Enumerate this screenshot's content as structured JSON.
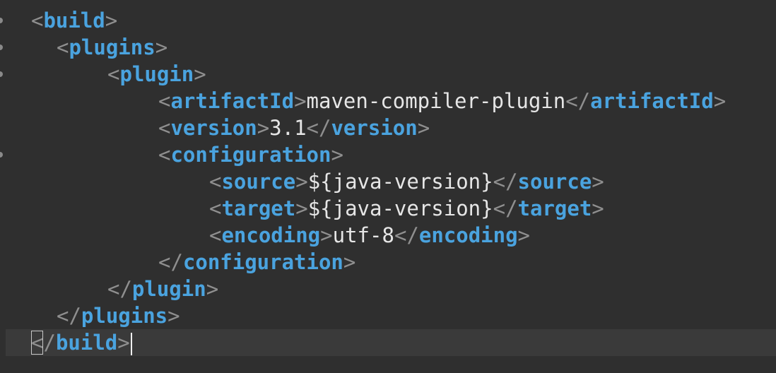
{
  "editor": {
    "colors": {
      "background": "#2f2f2f",
      "current_line": "#3a3a3a",
      "tag": "#4aa3df",
      "bracket": "#8f8f8f",
      "text": "#e6e6e6"
    },
    "lines": [
      {
        "indent": 0,
        "parts": [
          {
            "k": "b",
            "t": "<"
          },
          {
            "k": "g",
            "t": "build"
          },
          {
            "k": "b",
            "t": ">"
          }
        ]
      },
      {
        "indent": 1,
        "parts": [
          {
            "k": "b",
            "t": "<"
          },
          {
            "k": "g",
            "t": "plugins"
          },
          {
            "k": "b",
            "t": ">"
          }
        ]
      },
      {
        "indent": 3,
        "parts": [
          {
            "k": "b",
            "t": "<"
          },
          {
            "k": "g",
            "t": "plugin"
          },
          {
            "k": "b",
            "t": ">"
          }
        ]
      },
      {
        "indent": 5,
        "parts": [
          {
            "k": "b",
            "t": "<"
          },
          {
            "k": "g",
            "t": "artifactId"
          },
          {
            "k": "b",
            "t": ">"
          },
          {
            "k": "x",
            "t": "maven-compiler-plugin"
          },
          {
            "k": "b",
            "t": "</"
          },
          {
            "k": "g",
            "t": "artifactId"
          },
          {
            "k": "b",
            "t": ">"
          }
        ]
      },
      {
        "indent": 5,
        "parts": [
          {
            "k": "b",
            "t": "<"
          },
          {
            "k": "g",
            "t": "version"
          },
          {
            "k": "b",
            "t": ">"
          },
          {
            "k": "x",
            "t": "3.1"
          },
          {
            "k": "b",
            "t": "</"
          },
          {
            "k": "g",
            "t": "version"
          },
          {
            "k": "b",
            "t": ">"
          }
        ]
      },
      {
        "indent": 5,
        "parts": [
          {
            "k": "b",
            "t": "<"
          },
          {
            "k": "g",
            "t": "configuration"
          },
          {
            "k": "b",
            "t": ">"
          }
        ]
      },
      {
        "indent": 7,
        "parts": [
          {
            "k": "b",
            "t": "<"
          },
          {
            "k": "g",
            "t": "source"
          },
          {
            "k": "b",
            "t": ">"
          },
          {
            "k": "x",
            "t": "${java-version}"
          },
          {
            "k": "b",
            "t": "</"
          },
          {
            "k": "g",
            "t": "source"
          },
          {
            "k": "b",
            "t": ">"
          }
        ]
      },
      {
        "indent": 7,
        "parts": [
          {
            "k": "b",
            "t": "<"
          },
          {
            "k": "g",
            "t": "target"
          },
          {
            "k": "b",
            "t": ">"
          },
          {
            "k": "x",
            "t": "${java-version}"
          },
          {
            "k": "b",
            "t": "</"
          },
          {
            "k": "g",
            "t": "target"
          },
          {
            "k": "b",
            "t": ">"
          }
        ]
      },
      {
        "indent": 7,
        "parts": [
          {
            "k": "b",
            "t": "<"
          },
          {
            "k": "g",
            "t": "encoding"
          },
          {
            "k": "b",
            "t": ">"
          },
          {
            "k": "x",
            "t": "utf-8"
          },
          {
            "k": "b",
            "t": "</"
          },
          {
            "k": "g",
            "t": "encoding"
          },
          {
            "k": "b",
            "t": ">"
          }
        ]
      },
      {
        "indent": 5,
        "parts": [
          {
            "k": "b",
            "t": "</"
          },
          {
            "k": "g",
            "t": "configuration"
          },
          {
            "k": "b",
            "t": ">"
          }
        ]
      },
      {
        "indent": 3,
        "parts": [
          {
            "k": "b",
            "t": "</"
          },
          {
            "k": "g",
            "t": "plugin"
          },
          {
            "k": "b",
            "t": ">"
          }
        ]
      },
      {
        "indent": 1,
        "parts": [
          {
            "k": "b",
            "t": "</"
          },
          {
            "k": "g",
            "t": "plugins"
          },
          {
            "k": "b",
            "t": ">"
          }
        ]
      },
      {
        "indent": 0,
        "current": true,
        "parts": [
          {
            "k": "b",
            "t": "<",
            "matched": true
          },
          {
            "k": "b",
            "t": "/"
          },
          {
            "k": "g",
            "t": "build"
          },
          {
            "k": "b",
            "t": ">"
          }
        ],
        "caret": true
      }
    ]
  }
}
